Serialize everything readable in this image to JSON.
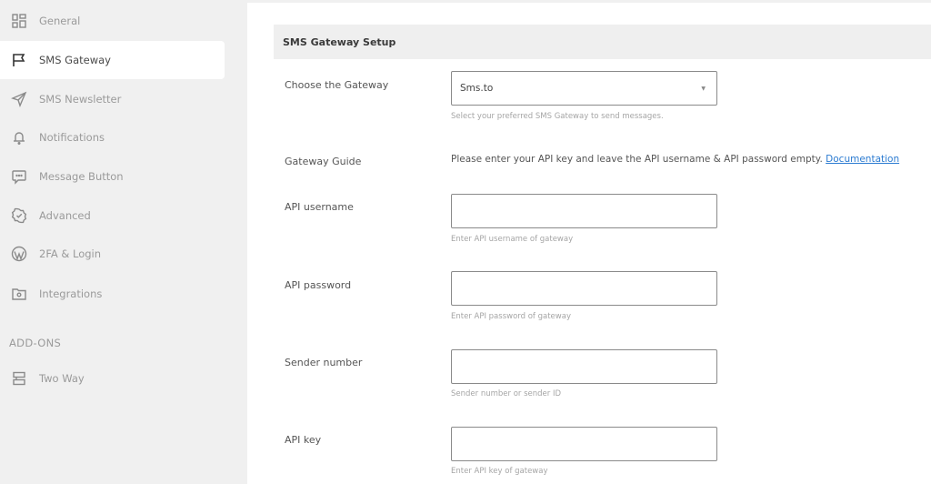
{
  "sidebar": {
    "items": [
      {
        "label": "General",
        "icon": "grid-icon",
        "active": false
      },
      {
        "label": "SMS Gateway",
        "icon": "flag-icon",
        "active": true
      },
      {
        "label": "SMS Newsletter",
        "icon": "send-icon",
        "active": false
      },
      {
        "label": "Notifications",
        "icon": "bell-icon",
        "active": false
      },
      {
        "label": "Message Button",
        "icon": "chat-icon",
        "active": false
      },
      {
        "label": "Advanced",
        "icon": "badge-check-icon",
        "active": false
      },
      {
        "label": "2FA & Login",
        "icon": "wordpress-icon",
        "active": false
      },
      {
        "label": "Integrations",
        "icon": "folder-gear-icon",
        "active": false
      }
    ],
    "addons_title": "ADD-ONS",
    "addons": [
      {
        "label": "Two Way",
        "icon": "two-way-icon"
      }
    ]
  },
  "main": {
    "section_title": "SMS Gateway Setup",
    "gateway": {
      "label": "Choose the Gateway",
      "value": "Sms.to",
      "help": "Select your preferred SMS Gateway to send messages."
    },
    "guide": {
      "label": "Gateway Guide",
      "text": "Please enter your API key and leave the API username & API password empty. ",
      "link_text": "Documentation"
    },
    "fields": [
      {
        "label": "API username",
        "value": "",
        "help": "Enter API username of gateway"
      },
      {
        "label": "API password",
        "value": "",
        "help": "Enter API password of gateway"
      },
      {
        "label": "Sender number",
        "value": "",
        "help": "Sender number or sender ID"
      },
      {
        "label": "API key",
        "value": "",
        "help": "Enter API key of gateway"
      }
    ]
  },
  "colors": {
    "sidebar_bg": "#f0f0f0",
    "active_item_bg": "#ffffff",
    "link": "#2b7bd1",
    "header_bg": "#efefef"
  }
}
